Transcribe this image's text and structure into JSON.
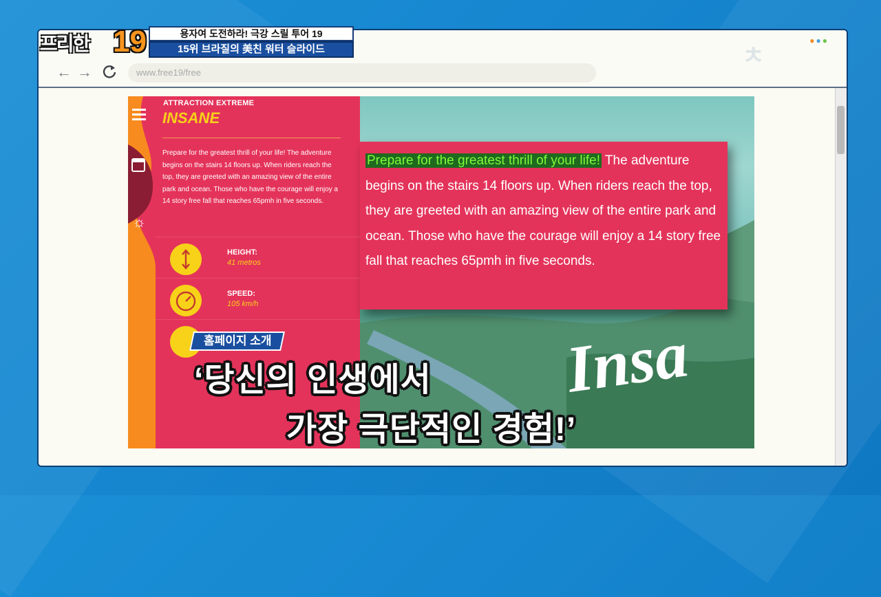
{
  "broadcast": {
    "show_logo_text": "프리한",
    "show_logo_number": "19",
    "headline_top": "용자여 도전하라! 극강 스릴 투어 19",
    "headline_bottom": "15위 브라질의 美친 워터 슬라이드",
    "caption_tag": "홈페이지 소개",
    "caption_line1": "‘당신의 인생에서",
    "caption_line2": "가장 극단적인 경험!’"
  },
  "browser": {
    "url": "www.free19/free",
    "back_icon": "back-arrow-icon",
    "forward_icon": "forward-arrow-icon",
    "reload_icon": "reload-icon"
  },
  "page": {
    "kicker": "ATTRACTION EXTREME",
    "title": "INSANE",
    "description": "Prepare for the greatest thrill of your life! The adventure begins on the stairs 14 floors up. When riders reach the top, they are greeted with an amazing view of the entire park and ocean. Those who have the courage will enjoy a 14 story free fall that reaches 65pmh in five seconds.",
    "stats": [
      {
        "label": "HEIGHT:",
        "value": "41 metros",
        "icon": "height-arrows-icon"
      },
      {
        "label": "SPEED:",
        "value": "105 km/h",
        "icon": "speedometer-icon"
      }
    ],
    "zoom_highlight": "Prepare for the greatest thrill of your life!",
    "zoom_rest": " The adventure begins on the stairs 14 floors up. When riders reach the top, they are greeted with an amazing view of the entire park and ocean. Those who have the courage will enjoy a 14 story free fall that reaches 65pmh in five seconds.",
    "photo_script": "Insa"
  },
  "colors": {
    "sidebar_pink": "#e4335a",
    "accent_yellow": "#f7d219",
    "highlight_green": "#7dfa3a",
    "frame_blue": "#1a8fd6"
  }
}
